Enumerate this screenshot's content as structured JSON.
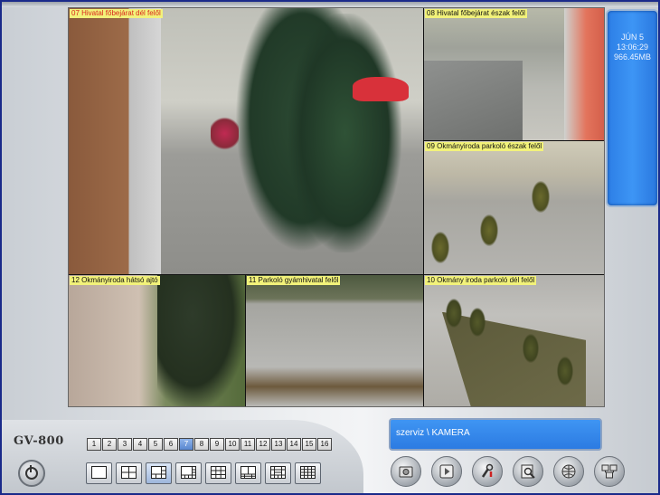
{
  "app": {
    "logo": "GV-800"
  },
  "cameras": [
    {
      "id": "cam07",
      "label": "07 Hivatal főbejárat dél felől"
    },
    {
      "id": "cam08",
      "label": "08 Hivatal főbejárat észak felől"
    },
    {
      "id": "cam09",
      "label": "09 Okmányiroda parkoló észak felől"
    },
    {
      "id": "cam12",
      "label": "12 Okmányiroda hátsó ajtó"
    },
    {
      "id": "cam11",
      "label": "11 Parkoló gyámhivatal felől"
    },
    {
      "id": "cam10",
      "label": "10 Okmány iroda parkoló dél felől"
    }
  ],
  "status": {
    "date": "JÚN 5",
    "time": "13:06:29",
    "storage": "966.45MB"
  },
  "camera_buttons": [
    "1",
    "2",
    "3",
    "4",
    "5",
    "6",
    "7",
    "8",
    "9",
    "10",
    "11",
    "12",
    "13",
    "14",
    "15",
    "16"
  ],
  "selected_camera": "7",
  "path_display": "szerviz \\ KAMERA",
  "layout_buttons": [
    "layout-1x1",
    "layout-2x2",
    "layout-6",
    "layout-8",
    "layout-9",
    "layout-10",
    "layout-13",
    "layout-16"
  ],
  "selected_layout": "layout-6",
  "tool_icons": [
    "camera-search-icon",
    "playback-icon",
    "tools-icon",
    "video-analysis-icon",
    "network-icon",
    "camera-config-icon"
  ],
  "colors": {
    "accent": "#3d95f5",
    "label_bg": "#f2f27a",
    "label_red": "#d9261c"
  }
}
